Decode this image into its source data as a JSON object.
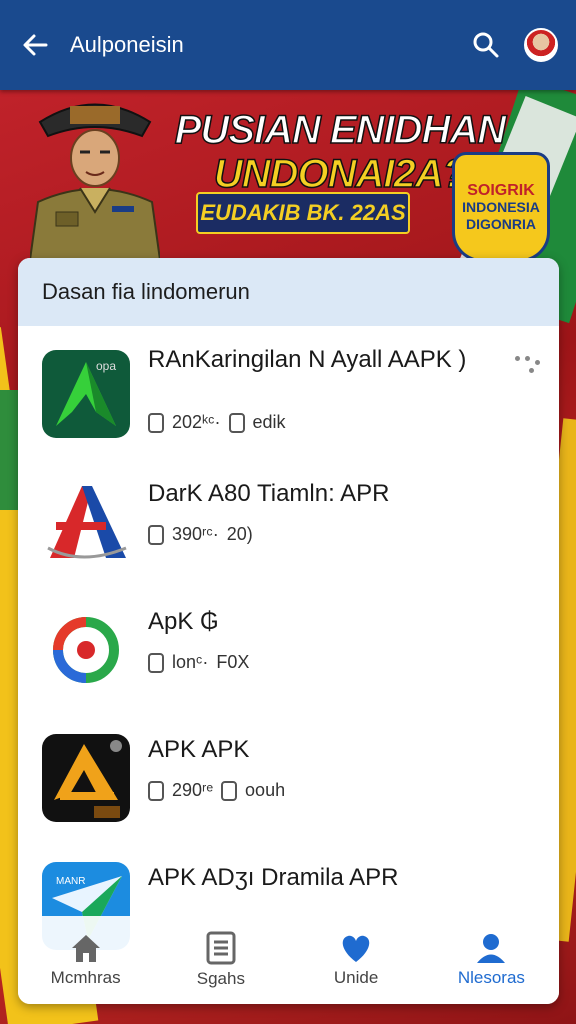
{
  "appbar": {
    "title": "Aulponeisin",
    "back_icon": "arrow-left-icon",
    "search_icon": "search-icon",
    "avatar": "user-avatar"
  },
  "banner": {
    "headline_line1": "PUSIAN ENIDHAN",
    "headline_line2": "UNDONAI2A?",
    "subline": "EUDAKIB BK. 22AS",
    "badge_lines": [
      "SOIGRIK",
      "INDONESIA",
      "DIGONRIA"
    ]
  },
  "list": {
    "header": "Dasan fia lindomerun",
    "items": [
      {
        "name": "RAnKaringilan N Ayall AAPK )",
        "meta1": "202ᵏᶜ·",
        "meta2": "edik",
        "icon": "green-arrow-app-icon",
        "has_more": true
      },
      {
        "name": "DarK A80 Tiamln: APR",
        "meta1": "390ʳᶜ·",
        "meta2": "20)",
        "icon": "red-blue-a-app-icon",
        "has_more": false
      },
      {
        "name": "ApK ₲",
        "meta1": "lonᶜ·",
        "meta2": "F0X",
        "icon": "ring-app-icon",
        "has_more": false
      },
      {
        "name": "APK APK",
        "meta1": "290ʳᵉ",
        "meta2": "oouh",
        "icon": "gold-triangle-app-icon",
        "has_more": false
      },
      {
        "name": "APK ADʒı Dramila APR",
        "meta1": "",
        "meta2": "",
        "icon": "blue-paper-plane-app-icon",
        "has_more": false
      }
    ]
  },
  "bottom_nav": [
    {
      "label": "Mcmhras",
      "icon": "home-icon",
      "active": false
    },
    {
      "label": "Sgahs",
      "icon": "document-icon",
      "active": false
    },
    {
      "label": "Unide",
      "icon": "heart-icon",
      "active": false
    },
    {
      "label": "Nlesoras",
      "icon": "profile-icon",
      "active": true
    }
  ],
  "colors": {
    "appbar": "#1a4a8e",
    "accent": "#1f6bd0",
    "banner_red": "#c0222a",
    "banner_yellow": "#f4cf23"
  }
}
